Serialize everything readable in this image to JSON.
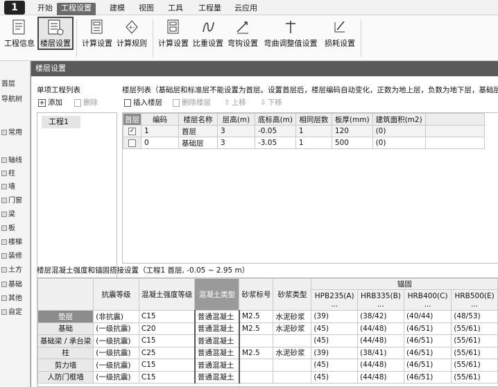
{
  "app": {
    "logo": "1"
  },
  "tabs": [
    {
      "label": "开始"
    },
    {
      "label": "工程设置",
      "active": true
    },
    {
      "label": "建模"
    },
    {
      "label": "视图"
    },
    {
      "label": "工具"
    },
    {
      "label": "工程量"
    },
    {
      "label": "云应用"
    }
  ],
  "ribbon": [
    {
      "label": "工程信息",
      "icon": "project-info-icon"
    },
    {
      "label": "楼层设置",
      "icon": "floor-settings-icon",
      "selected": true
    },
    {
      "label": "计算设置",
      "icon": "calc-settings-icon"
    },
    {
      "label": "计算规则",
      "icon": "calc-rules-icon"
    },
    {
      "label": "计算设置",
      "icon": "calc-settings-2-icon"
    },
    {
      "label": "比重设置",
      "icon": "density-settings-icon"
    },
    {
      "label": "弯钩设置",
      "icon": "hook-settings-icon"
    },
    {
      "label": "弯曲调整值设置",
      "icon": "bend-adjust-icon"
    },
    {
      "label": "损耗设置",
      "icon": "loss-settings-icon"
    }
  ],
  "left_strip": [
    {
      "label": "首层"
    },
    {
      "label": "导航树"
    },
    {
      "label": "常用"
    },
    {
      "label": "轴线"
    },
    {
      "label": "柱"
    },
    {
      "label": "墙"
    },
    {
      "label": "门窗"
    },
    {
      "label": "梁"
    },
    {
      "label": "板"
    },
    {
      "label": "楼梯"
    },
    {
      "label": "装修"
    },
    {
      "label": "土方"
    },
    {
      "label": "基础"
    },
    {
      "label": "其他"
    },
    {
      "label": "自定"
    }
  ],
  "dialog": {
    "title": "楼层设置",
    "project_list_title": "单项工程列表",
    "add_label": "添加",
    "delete_label": "删除",
    "project_item": "工程1",
    "floor_list_title": "楼层列表（基础层和标准层不能设置为首层。设置首层后，楼层编码自动变化，正数为地上层，负数为地下层，基础层编",
    "insert_floor": "插入楼层",
    "delete_floor": "删除楼层",
    "move_up": "上移",
    "move_down": "下移"
  },
  "floor_table": {
    "headers": [
      "首层",
      "编码",
      "楼层名称",
      "层高(m)",
      "底标高(m)",
      "相同层数",
      "板厚(mm)",
      "建筑面积(m2)"
    ],
    "rows": [
      {
        "checked": true,
        "code": "1",
        "name": "首层",
        "height": "3",
        "bottom": "-0.05",
        "same": "1",
        "thick": "120",
        "area": "(0)"
      },
      {
        "checked": false,
        "code": "0",
        "name": "基础层",
        "height": "3",
        "bottom": "-3.05",
        "same": "1",
        "thick": "500",
        "area": "(0)"
      }
    ]
  },
  "concrete_section": {
    "title": "楼层混凝土强度和锚固搭接设置（工程1 首层, -0.05 ~ 2.95 m）",
    "headers": {
      "seismic": "抗震等级",
      "strength": "混凝土强度等级",
      "type": "混凝土类型",
      "mortar_grade": "砂浆标号",
      "mortar_type": "砂浆类型",
      "anchor": "锚固",
      "hpb235": "HPB235(A)",
      "hrb335": "HRB335(B)",
      "hrb400": "HRB400(C)",
      "hrb500": "HRB500(E)",
      "ellipsis": "..."
    },
    "rows": [
      {
        "name": "垫层",
        "seismic": "(非抗震)",
        "strength": "C15",
        "type": "普通混凝土",
        "mg": "M2.5",
        "mt": "水泥砂浆",
        "a": "(39)",
        "b": "(38/42)",
        "c": "(40/44)",
        "e": "(48/53)",
        "hl": true
      },
      {
        "name": "基础",
        "seismic": "(一级抗震)",
        "strength": "C20",
        "type": "普通混凝土",
        "mg": "M2.5",
        "mt": "水泥砂浆",
        "a": "(45)",
        "b": "(44/48)",
        "c": "(46/51)",
        "e": "(55/61)"
      },
      {
        "name": "基础梁 / 承台梁",
        "seismic": "(一级抗震)",
        "strength": "C15",
        "type": "普通混凝土",
        "mg": "",
        "mt": "",
        "a": "(45)",
        "b": "(44/48)",
        "c": "(46/51)",
        "e": "(55/61)"
      },
      {
        "name": "柱",
        "seismic": "(一级抗震)",
        "strength": "C25",
        "type": "普通混凝土",
        "mg": "M2.5",
        "mt": "水泥砂浆",
        "a": "(39)",
        "b": "(38/41)",
        "c": "(46/51)",
        "e": "(55/61)"
      },
      {
        "name": "剪力墙",
        "seismic": "(一级抗震)",
        "strength": "C15",
        "type": "普通混凝土",
        "mg": "",
        "mt": "",
        "a": "(45)",
        "b": "(44/48)",
        "c": "(46/51)",
        "e": "(55/61)"
      },
      {
        "name": "人防门框墙",
        "seismic": "(一级抗震)",
        "strength": "C15",
        "type": "普通混凝土",
        "mg": "",
        "mt": "",
        "a": "(45)",
        "b": "(44/48)",
        "c": "(46/51)",
        "e": "(55/61)"
      }
    ]
  }
}
